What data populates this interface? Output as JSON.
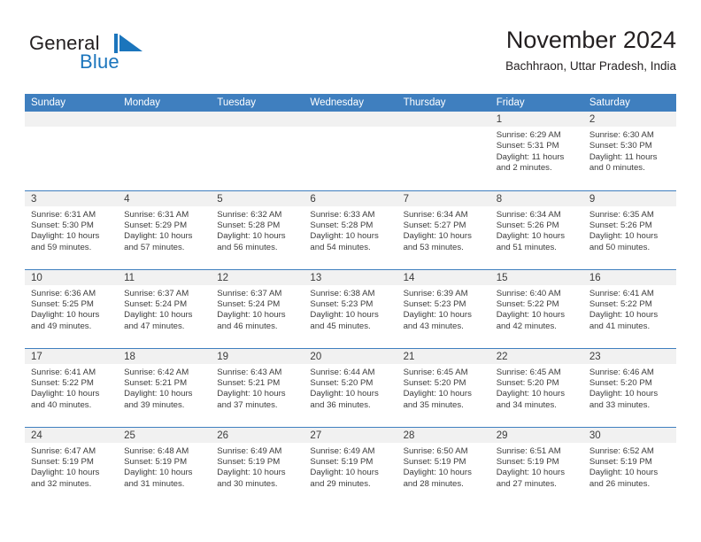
{
  "brand": {
    "name_part1": "General",
    "name_part2": "Blue",
    "logo_icon": "blue-flag-triangle-icon",
    "accent_color": "#1b75bc"
  },
  "header": {
    "title": "November 2024",
    "subtitle": "Bachhraon, Uttar Pradesh, India"
  },
  "theme": {
    "header_row_bg": "#3f7fbf",
    "daynum_bg": "#f1f1f1",
    "text_color": "#3c3c3c",
    "row_divider": "#3f7fbf"
  },
  "calendar": {
    "weekday_headers": [
      "Sunday",
      "Monday",
      "Tuesday",
      "Wednesday",
      "Thursday",
      "Friday",
      "Saturday"
    ],
    "weeks": [
      [
        {
          "day": "",
          "sunrise": "",
          "sunset": "",
          "daylight_line1": "",
          "daylight_line2": "",
          "blank": true
        },
        {
          "day": "",
          "sunrise": "",
          "sunset": "",
          "daylight_line1": "",
          "daylight_line2": "",
          "blank": true
        },
        {
          "day": "",
          "sunrise": "",
          "sunset": "",
          "daylight_line1": "",
          "daylight_line2": "",
          "blank": true
        },
        {
          "day": "",
          "sunrise": "",
          "sunset": "",
          "daylight_line1": "",
          "daylight_line2": "",
          "blank": true
        },
        {
          "day": "",
          "sunrise": "",
          "sunset": "",
          "daylight_line1": "",
          "daylight_line2": "",
          "blank": true
        },
        {
          "day": "1",
          "sunrise": "Sunrise: 6:29 AM",
          "sunset": "Sunset: 5:31 PM",
          "daylight_line1": "Daylight: 11 hours",
          "daylight_line2": "and 2 minutes.",
          "blank": false
        },
        {
          "day": "2",
          "sunrise": "Sunrise: 6:30 AM",
          "sunset": "Sunset: 5:30 PM",
          "daylight_line1": "Daylight: 11 hours",
          "daylight_line2": "and 0 minutes.",
          "blank": false
        }
      ],
      [
        {
          "day": "3",
          "sunrise": "Sunrise: 6:31 AM",
          "sunset": "Sunset: 5:30 PM",
          "daylight_line1": "Daylight: 10 hours",
          "daylight_line2": "and 59 minutes.",
          "blank": false
        },
        {
          "day": "4",
          "sunrise": "Sunrise: 6:31 AM",
          "sunset": "Sunset: 5:29 PM",
          "daylight_line1": "Daylight: 10 hours",
          "daylight_line2": "and 57 minutes.",
          "blank": false
        },
        {
          "day": "5",
          "sunrise": "Sunrise: 6:32 AM",
          "sunset": "Sunset: 5:28 PM",
          "daylight_line1": "Daylight: 10 hours",
          "daylight_line2": "and 56 minutes.",
          "blank": false
        },
        {
          "day": "6",
          "sunrise": "Sunrise: 6:33 AM",
          "sunset": "Sunset: 5:28 PM",
          "daylight_line1": "Daylight: 10 hours",
          "daylight_line2": "and 54 minutes.",
          "blank": false
        },
        {
          "day": "7",
          "sunrise": "Sunrise: 6:34 AM",
          "sunset": "Sunset: 5:27 PM",
          "daylight_line1": "Daylight: 10 hours",
          "daylight_line2": "and 53 minutes.",
          "blank": false
        },
        {
          "day": "8",
          "sunrise": "Sunrise: 6:34 AM",
          "sunset": "Sunset: 5:26 PM",
          "daylight_line1": "Daylight: 10 hours",
          "daylight_line2": "and 51 minutes.",
          "blank": false
        },
        {
          "day": "9",
          "sunrise": "Sunrise: 6:35 AM",
          "sunset": "Sunset: 5:26 PM",
          "daylight_line1": "Daylight: 10 hours",
          "daylight_line2": "and 50 minutes.",
          "blank": false
        }
      ],
      [
        {
          "day": "10",
          "sunrise": "Sunrise: 6:36 AM",
          "sunset": "Sunset: 5:25 PM",
          "daylight_line1": "Daylight: 10 hours",
          "daylight_line2": "and 49 minutes.",
          "blank": false
        },
        {
          "day": "11",
          "sunrise": "Sunrise: 6:37 AM",
          "sunset": "Sunset: 5:24 PM",
          "daylight_line1": "Daylight: 10 hours",
          "daylight_line2": "and 47 minutes.",
          "blank": false
        },
        {
          "day": "12",
          "sunrise": "Sunrise: 6:37 AM",
          "sunset": "Sunset: 5:24 PM",
          "daylight_line1": "Daylight: 10 hours",
          "daylight_line2": "and 46 minutes.",
          "blank": false
        },
        {
          "day": "13",
          "sunrise": "Sunrise: 6:38 AM",
          "sunset": "Sunset: 5:23 PM",
          "daylight_line1": "Daylight: 10 hours",
          "daylight_line2": "and 45 minutes.",
          "blank": false
        },
        {
          "day": "14",
          "sunrise": "Sunrise: 6:39 AM",
          "sunset": "Sunset: 5:23 PM",
          "daylight_line1": "Daylight: 10 hours",
          "daylight_line2": "and 43 minutes.",
          "blank": false
        },
        {
          "day": "15",
          "sunrise": "Sunrise: 6:40 AM",
          "sunset": "Sunset: 5:22 PM",
          "daylight_line1": "Daylight: 10 hours",
          "daylight_line2": "and 42 minutes.",
          "blank": false
        },
        {
          "day": "16",
          "sunrise": "Sunrise: 6:41 AM",
          "sunset": "Sunset: 5:22 PM",
          "daylight_line1": "Daylight: 10 hours",
          "daylight_line2": "and 41 minutes.",
          "blank": false
        }
      ],
      [
        {
          "day": "17",
          "sunrise": "Sunrise: 6:41 AM",
          "sunset": "Sunset: 5:22 PM",
          "daylight_line1": "Daylight: 10 hours",
          "daylight_line2": "and 40 minutes.",
          "blank": false
        },
        {
          "day": "18",
          "sunrise": "Sunrise: 6:42 AM",
          "sunset": "Sunset: 5:21 PM",
          "daylight_line1": "Daylight: 10 hours",
          "daylight_line2": "and 39 minutes.",
          "blank": false
        },
        {
          "day": "19",
          "sunrise": "Sunrise: 6:43 AM",
          "sunset": "Sunset: 5:21 PM",
          "daylight_line1": "Daylight: 10 hours",
          "daylight_line2": "and 37 minutes.",
          "blank": false
        },
        {
          "day": "20",
          "sunrise": "Sunrise: 6:44 AM",
          "sunset": "Sunset: 5:20 PM",
          "daylight_line1": "Daylight: 10 hours",
          "daylight_line2": "and 36 minutes.",
          "blank": false
        },
        {
          "day": "21",
          "sunrise": "Sunrise: 6:45 AM",
          "sunset": "Sunset: 5:20 PM",
          "daylight_line1": "Daylight: 10 hours",
          "daylight_line2": "and 35 minutes.",
          "blank": false
        },
        {
          "day": "22",
          "sunrise": "Sunrise: 6:45 AM",
          "sunset": "Sunset: 5:20 PM",
          "daylight_line1": "Daylight: 10 hours",
          "daylight_line2": "and 34 minutes.",
          "blank": false
        },
        {
          "day": "23",
          "sunrise": "Sunrise: 6:46 AM",
          "sunset": "Sunset: 5:20 PM",
          "daylight_line1": "Daylight: 10 hours",
          "daylight_line2": "and 33 minutes.",
          "blank": false
        }
      ],
      [
        {
          "day": "24",
          "sunrise": "Sunrise: 6:47 AM",
          "sunset": "Sunset: 5:19 PM",
          "daylight_line1": "Daylight: 10 hours",
          "daylight_line2": "and 32 minutes.",
          "blank": false
        },
        {
          "day": "25",
          "sunrise": "Sunrise: 6:48 AM",
          "sunset": "Sunset: 5:19 PM",
          "daylight_line1": "Daylight: 10 hours",
          "daylight_line2": "and 31 minutes.",
          "blank": false
        },
        {
          "day": "26",
          "sunrise": "Sunrise: 6:49 AM",
          "sunset": "Sunset: 5:19 PM",
          "daylight_line1": "Daylight: 10 hours",
          "daylight_line2": "and 30 minutes.",
          "blank": false
        },
        {
          "day": "27",
          "sunrise": "Sunrise: 6:49 AM",
          "sunset": "Sunset: 5:19 PM",
          "daylight_line1": "Daylight: 10 hours",
          "daylight_line2": "and 29 minutes.",
          "blank": false
        },
        {
          "day": "28",
          "sunrise": "Sunrise: 6:50 AM",
          "sunset": "Sunset: 5:19 PM",
          "daylight_line1": "Daylight: 10 hours",
          "daylight_line2": "and 28 minutes.",
          "blank": false
        },
        {
          "day": "29",
          "sunrise": "Sunrise: 6:51 AM",
          "sunset": "Sunset: 5:19 PM",
          "daylight_line1": "Daylight: 10 hours",
          "daylight_line2": "and 27 minutes.",
          "blank": false
        },
        {
          "day": "30",
          "sunrise": "Sunrise: 6:52 AM",
          "sunset": "Sunset: 5:19 PM",
          "daylight_line1": "Daylight: 10 hours",
          "daylight_line2": "and 26 minutes.",
          "blank": false
        }
      ]
    ]
  }
}
